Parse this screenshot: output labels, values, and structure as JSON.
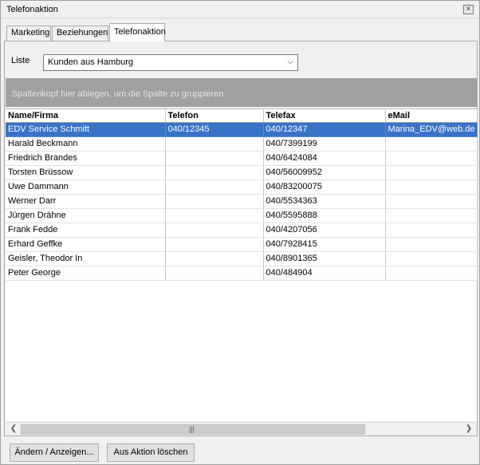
{
  "window": {
    "title": "Telefonaktion",
    "close_glyph": "×"
  },
  "tabs": [
    {
      "label": "Marketing"
    },
    {
      "label": "Beziehungen"
    },
    {
      "label": "Telefonaktion"
    }
  ],
  "filter": {
    "label": "Liste",
    "selected": "Kunden aus Hamburg"
  },
  "group_hint": "Spaltenkopf hier ablegen, um die Spalte zu gruppieren",
  "table": {
    "columns": [
      "Name/Firma",
      "Telefon",
      "Telefax",
      "eMail"
    ],
    "rows": [
      [
        "EDV Service Schmitt",
        "040/12345",
        "040/12347",
        "Marina_EDV@web.de"
      ],
      [
        "Harald Beckmann",
        "",
        "040/7399199",
        ""
      ],
      [
        "Friedrich Brandes",
        "",
        "040/6424084",
        ""
      ],
      [
        "Torsten Brüssow",
        "",
        "040/56009952",
        ""
      ],
      [
        "Uwe Dammann",
        "",
        "040/83200075",
        ""
      ],
      [
        "Werner Darr",
        "",
        "040/5534363",
        ""
      ],
      [
        "Jürgen Drähne",
        "",
        "040/5595888",
        ""
      ],
      [
        "Frank Fedde",
        "",
        "040/4207056",
        ""
      ],
      [
        "Erhard Geffke",
        "",
        "040/7928415",
        ""
      ],
      [
        " Geisler, Theodor In",
        "",
        "040/8901365",
        ""
      ],
      [
        "Peter George",
        "",
        "040/484904",
        ""
      ]
    ],
    "selected_row": 0
  },
  "buttons": {
    "edit": "Ändern / Anzeigen...",
    "remove": "Aus Aktion löschen"
  },
  "colors": {
    "selection": "#3873c8",
    "group_bar": "#a0a0a0"
  }
}
